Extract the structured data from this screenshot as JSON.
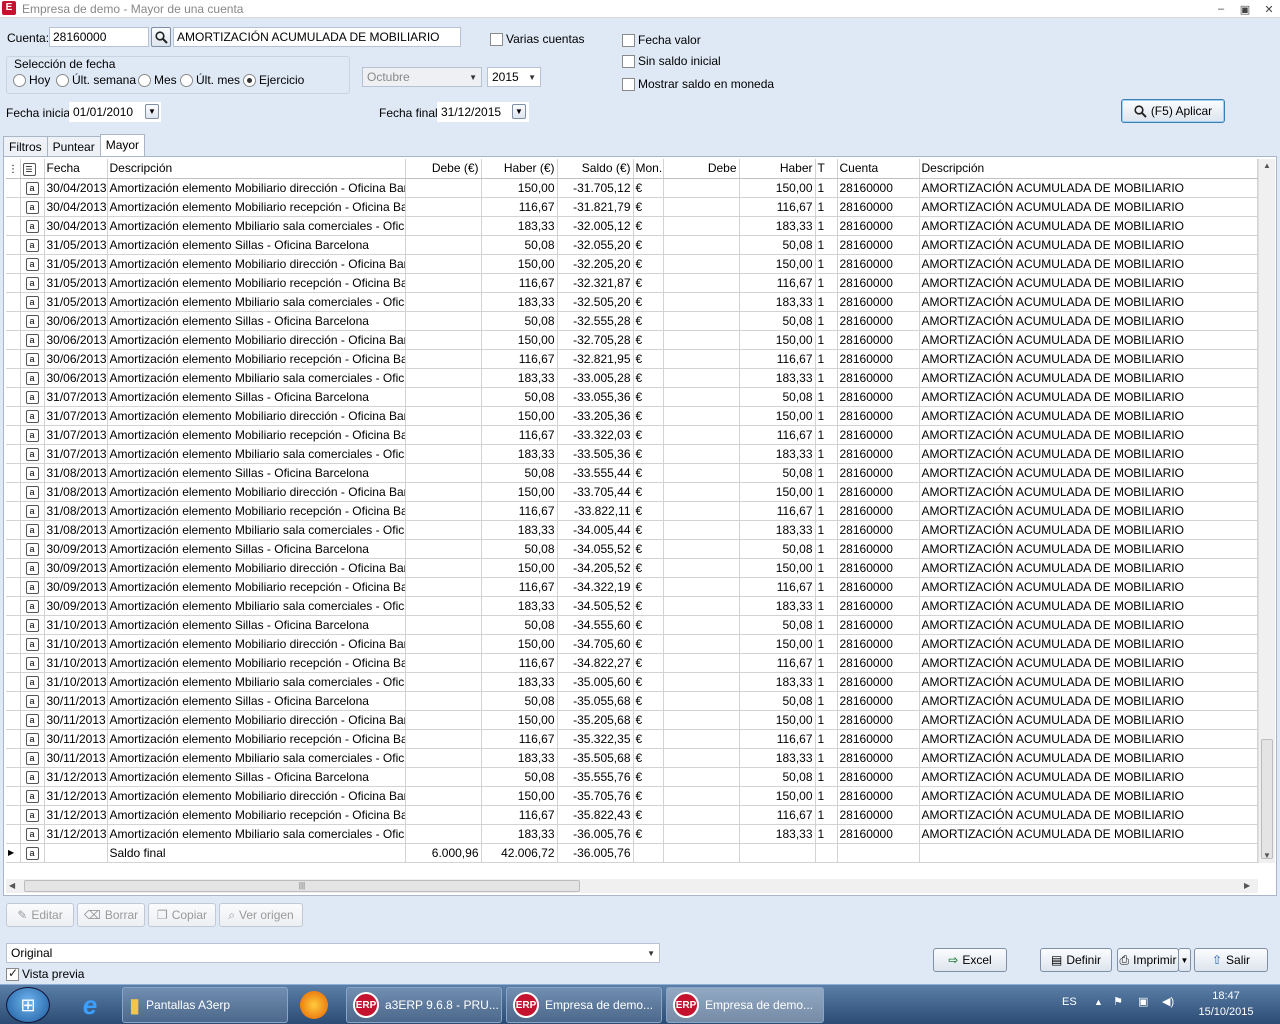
{
  "window": {
    "app_icon": "E",
    "title": "Empresa de demo - Mayor de una cuenta",
    "minimize": "–",
    "restore": "▣",
    "close": "✕"
  },
  "filters": {
    "cuenta_label": "Cuenta:",
    "cuenta_value": "28160000",
    "cuenta_desc": "AMORTIZACIÓN ACUMULADA DE MOBILIARIO",
    "varias_cuentas": "Varias cuentas",
    "fecha_valor": "Fecha valor",
    "sin_saldo_inicial": "Sin saldo inicial",
    "mostrar_saldo": "Mostrar saldo en moneda",
    "seleccion_fecha": "Selección de fecha",
    "radios": [
      "Hoy",
      "Últ. semana",
      "Mes",
      "Últ. mes",
      "Ejercicio"
    ],
    "mes_value": "Octubre",
    "anio_value": "2015",
    "fecha_inicial_label": "Fecha inicial:",
    "fecha_inicial": "01/01/2010",
    "fecha_final_label": "Fecha final:",
    "fecha_final": "31/12/2015",
    "aplicar": "(F5) Aplicar"
  },
  "tabs": [
    "Filtros",
    "Puntear",
    "Mayor"
  ],
  "grid": {
    "columns": [
      "Fecha",
      "Descripción",
      "Debe (€)",
      "Haber (€)",
      "Saldo (€)",
      "Mon.",
      "Debe",
      "Haber",
      "T",
      "Cuenta",
      "Descripción"
    ],
    "currency": "€",
    "tipo": "1",
    "cuenta": "28160000",
    "cuenta_desc": "AMORTIZACIÓN ACUMULADA DE MOBILIARIO",
    "row_icon": "a",
    "rows": [
      [
        "30/04/2013",
        "Amortización elemento Mobiliario dirección - Oficina Barcelona",
        "",
        "150,00",
        "-31.705,12",
        "150,00"
      ],
      [
        "30/04/2013",
        "Amortización elemento Mobiliario recepción - Oficina Barcelona",
        "",
        "116,67",
        "-31.821,79",
        "116,67"
      ],
      [
        "30/04/2013",
        "Amortización elemento Mbiliario sala comerciales - Oficina Barcelona",
        "",
        "183,33",
        "-32.005,12",
        "183,33"
      ],
      [
        "31/05/2013",
        "Amortización elemento Sillas - Oficina Barcelona",
        "",
        "50,08",
        "-32.055,20",
        "50,08"
      ],
      [
        "31/05/2013",
        "Amortización elemento Mobiliario dirección - Oficina Barcelona",
        "",
        "150,00",
        "-32.205,20",
        "150,00"
      ],
      [
        "31/05/2013",
        "Amortización elemento Mobiliario recepción - Oficina Barcelona",
        "",
        "116,67",
        "-32.321,87",
        "116,67"
      ],
      [
        "31/05/2013",
        "Amortización elemento Mbiliario sala comerciales - Oficina Barcelona",
        "",
        "183,33",
        "-32.505,20",
        "183,33"
      ],
      [
        "30/06/2013",
        "Amortización elemento Sillas - Oficina Barcelona",
        "",
        "50,08",
        "-32.555,28",
        "50,08"
      ],
      [
        "30/06/2013",
        "Amortización elemento Mobiliario dirección - Oficina Barcelona",
        "",
        "150,00",
        "-32.705,28",
        "150,00"
      ],
      [
        "30/06/2013",
        "Amortización elemento Mobiliario recepción - Oficina Barcelona",
        "",
        "116,67",
        "-32.821,95",
        "116,67"
      ],
      [
        "30/06/2013",
        "Amortización elemento Mbiliario sala comerciales - Oficina Barcelona",
        "",
        "183,33",
        "-33.005,28",
        "183,33"
      ],
      [
        "31/07/2013",
        "Amortización elemento Sillas - Oficina Barcelona",
        "",
        "50,08",
        "-33.055,36",
        "50,08"
      ],
      [
        "31/07/2013",
        "Amortización elemento Mobiliario dirección - Oficina Barcelona",
        "",
        "150,00",
        "-33.205,36",
        "150,00"
      ],
      [
        "31/07/2013",
        "Amortización elemento Mobiliario recepción - Oficina Barcelona",
        "",
        "116,67",
        "-33.322,03",
        "116,67"
      ],
      [
        "31/07/2013",
        "Amortización elemento Mbiliario sala comerciales - Oficina Barcelona",
        "",
        "183,33",
        "-33.505,36",
        "183,33"
      ],
      [
        "31/08/2013",
        "Amortización elemento Sillas - Oficina Barcelona",
        "",
        "50,08",
        "-33.555,44",
        "50,08"
      ],
      [
        "31/08/2013",
        "Amortización elemento Mobiliario dirección - Oficina Barcelona",
        "",
        "150,00",
        "-33.705,44",
        "150,00"
      ],
      [
        "31/08/2013",
        "Amortización elemento Mobiliario recepción - Oficina Barcelona",
        "",
        "116,67",
        "-33.822,11",
        "116,67"
      ],
      [
        "31/08/2013",
        "Amortización elemento Mbiliario sala comerciales - Oficina Barcelona",
        "",
        "183,33",
        "-34.005,44",
        "183,33"
      ],
      [
        "30/09/2013",
        "Amortización elemento Sillas - Oficina Barcelona",
        "",
        "50,08",
        "-34.055,52",
        "50,08"
      ],
      [
        "30/09/2013",
        "Amortización elemento Mobiliario dirección - Oficina Barcelona",
        "",
        "150,00",
        "-34.205,52",
        "150,00"
      ],
      [
        "30/09/2013",
        "Amortización elemento Mobiliario recepción - Oficina Barcelona",
        "",
        "116,67",
        "-34.322,19",
        "116,67"
      ],
      [
        "30/09/2013",
        "Amortización elemento Mbiliario sala comerciales - Oficina Barcelona",
        "",
        "183,33",
        "-34.505,52",
        "183,33"
      ],
      [
        "31/10/2013",
        "Amortización elemento Sillas - Oficina Barcelona",
        "",
        "50,08",
        "-34.555,60",
        "50,08"
      ],
      [
        "31/10/2013",
        "Amortización elemento Mobiliario dirección - Oficina Barcelona",
        "",
        "150,00",
        "-34.705,60",
        "150,00"
      ],
      [
        "31/10/2013",
        "Amortización elemento Mobiliario recepción - Oficina Barcelona",
        "",
        "116,67",
        "-34.822,27",
        "116,67"
      ],
      [
        "31/10/2013",
        "Amortización elemento Mbiliario sala comerciales - Oficina Barcelona",
        "",
        "183,33",
        "-35.005,60",
        "183,33"
      ],
      [
        "30/11/2013",
        "Amortización elemento Sillas - Oficina Barcelona",
        "",
        "50,08",
        "-35.055,68",
        "50,08"
      ],
      [
        "30/11/2013",
        "Amortización elemento Mobiliario dirección - Oficina Barcelona",
        "",
        "150,00",
        "-35.205,68",
        "150,00"
      ],
      [
        "30/11/2013",
        "Amortización elemento Mobiliario recepción - Oficina Barcelona",
        "",
        "116,67",
        "-35.322,35",
        "116,67"
      ],
      [
        "30/11/2013",
        "Amortización elemento Mbiliario sala comerciales - Oficina Barcelona",
        "",
        "183,33",
        "-35.505,68",
        "183,33"
      ],
      [
        "31/12/2013",
        "Amortización elemento Sillas - Oficina Barcelona",
        "",
        "50,08",
        "-35.555,76",
        "50,08"
      ],
      [
        "31/12/2013",
        "Amortización elemento Mobiliario dirección - Oficina Barcelona",
        "",
        "150,00",
        "-35.705,76",
        "150,00"
      ],
      [
        "31/12/2013",
        "Amortización elemento Mobiliario recepción - Oficina Barcelona",
        "",
        "116,67",
        "-35.822,43",
        "116,67"
      ],
      [
        "31/12/2013",
        "Amortización elemento Mbiliario sala comerciales - Oficina Barcelona",
        "",
        "183,33",
        "-36.005,76",
        "183,33"
      ]
    ],
    "total": {
      "label": "Saldo final",
      "debe": "6.000,96",
      "haber": "42.006,72",
      "saldo": "-36.005,76"
    }
  },
  "actions": {
    "editar": "Editar",
    "borrar": "Borrar",
    "copiar": "Copiar",
    "ver_origen": "Ver origen"
  },
  "bottom": {
    "format": "Original",
    "vista_previa": "Vista previa",
    "excel": "Excel",
    "definir": "Definir",
    "imprimir": "Imprimir",
    "salir": "Salir"
  },
  "taskbar": {
    "items": [
      "Pantallas A3erp",
      "a3ERP 9.6.8 - PRU...",
      "Empresa de demo...",
      "Empresa de demo..."
    ],
    "erp_badge": "ERP",
    "lang": "ES",
    "time": "18:47",
    "date": "15/10/2015"
  }
}
